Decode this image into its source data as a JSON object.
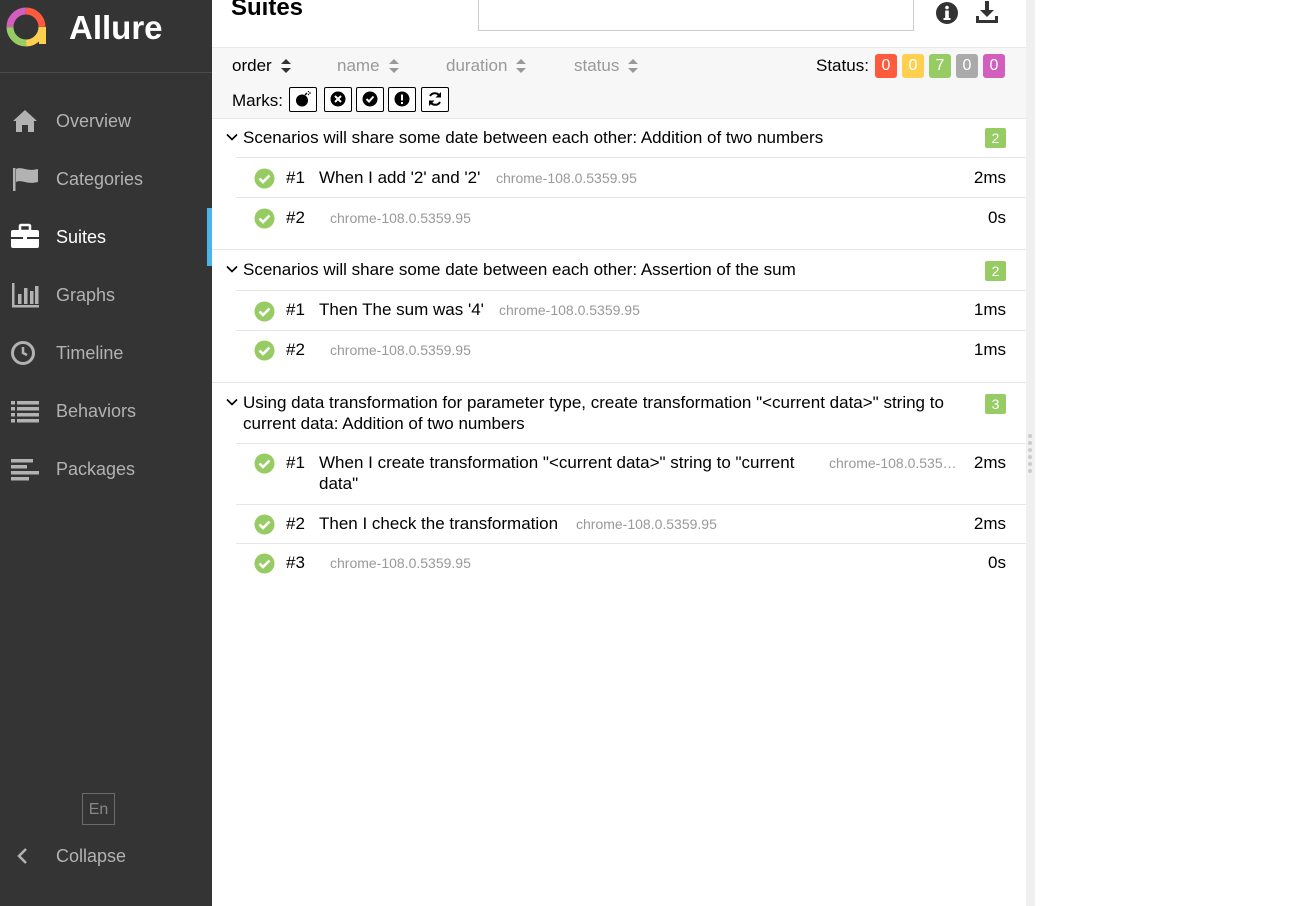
{
  "app": {
    "name": "Allure"
  },
  "sidebar": {
    "items": [
      {
        "label": "Overview",
        "icon": "home-icon"
      },
      {
        "label": "Categories",
        "icon": "flag-icon"
      },
      {
        "label": "Suites",
        "icon": "briefcase-icon",
        "active": true
      },
      {
        "label": "Graphs",
        "icon": "bar-chart-icon"
      },
      {
        "label": "Timeline",
        "icon": "clock-icon"
      },
      {
        "label": "Behaviors",
        "icon": "list-icon"
      },
      {
        "label": "Packages",
        "icon": "align-left-icon"
      }
    ],
    "language": "En",
    "collapse_label": "Collapse"
  },
  "header": {
    "title": "Suites",
    "search_value": ""
  },
  "toolbar": {
    "sort": {
      "order": "order",
      "name": "name",
      "duration": "duration",
      "status": "status"
    },
    "status_label": "Status:",
    "status_counts": [
      {
        "value": "0",
        "color": "#fd5a3e"
      },
      {
        "value": "0",
        "color": "#ffd050"
      },
      {
        "value": "7",
        "color": "#97cc64"
      },
      {
        "value": "0",
        "color": "#aaaaaa"
      },
      {
        "value": "0",
        "color": "#d35ebe"
      }
    ],
    "marks_label": "Marks:"
  },
  "groups": [
    {
      "title": "Scenarios will share some date between each other: Addition of two numbers",
      "count": "2",
      "rows": [
        {
          "num": "#1",
          "name": "When I add '2' and '2'",
          "param": "chrome-108.0.5359.95",
          "duration": "2ms"
        },
        {
          "num": "#2",
          "name": "",
          "param": "chrome-108.0.5359.95",
          "duration": "0s"
        }
      ]
    },
    {
      "title": "Scenarios will share some date between each other: Assertion of the sum",
      "count": "2",
      "rows": [
        {
          "num": "#1",
          "name": "Then The sum was '4'",
          "param": "chrome-108.0.5359.95",
          "duration": "1ms"
        },
        {
          "num": "#2",
          "name": "",
          "param": "chrome-108.0.5359.95",
          "duration": "1ms"
        }
      ]
    },
    {
      "title": "Using data transformation for parameter type, create transformation \"<current data>\" string to current data: Addition of two numbers",
      "count": "3",
      "rows": [
        {
          "num": "#1",
          "name": "When I create transformation \"<current data>\" string to \"current data\"",
          "param": "chrome-108.0.535…",
          "duration": "2ms"
        },
        {
          "num": "#2",
          "name": "Then I check the transformation",
          "param": "chrome-108.0.5359.95",
          "duration": "2ms"
        },
        {
          "num": "#3",
          "name": "",
          "param": "chrome-108.0.5359.95",
          "duration": "0s"
        }
      ]
    }
  ]
}
